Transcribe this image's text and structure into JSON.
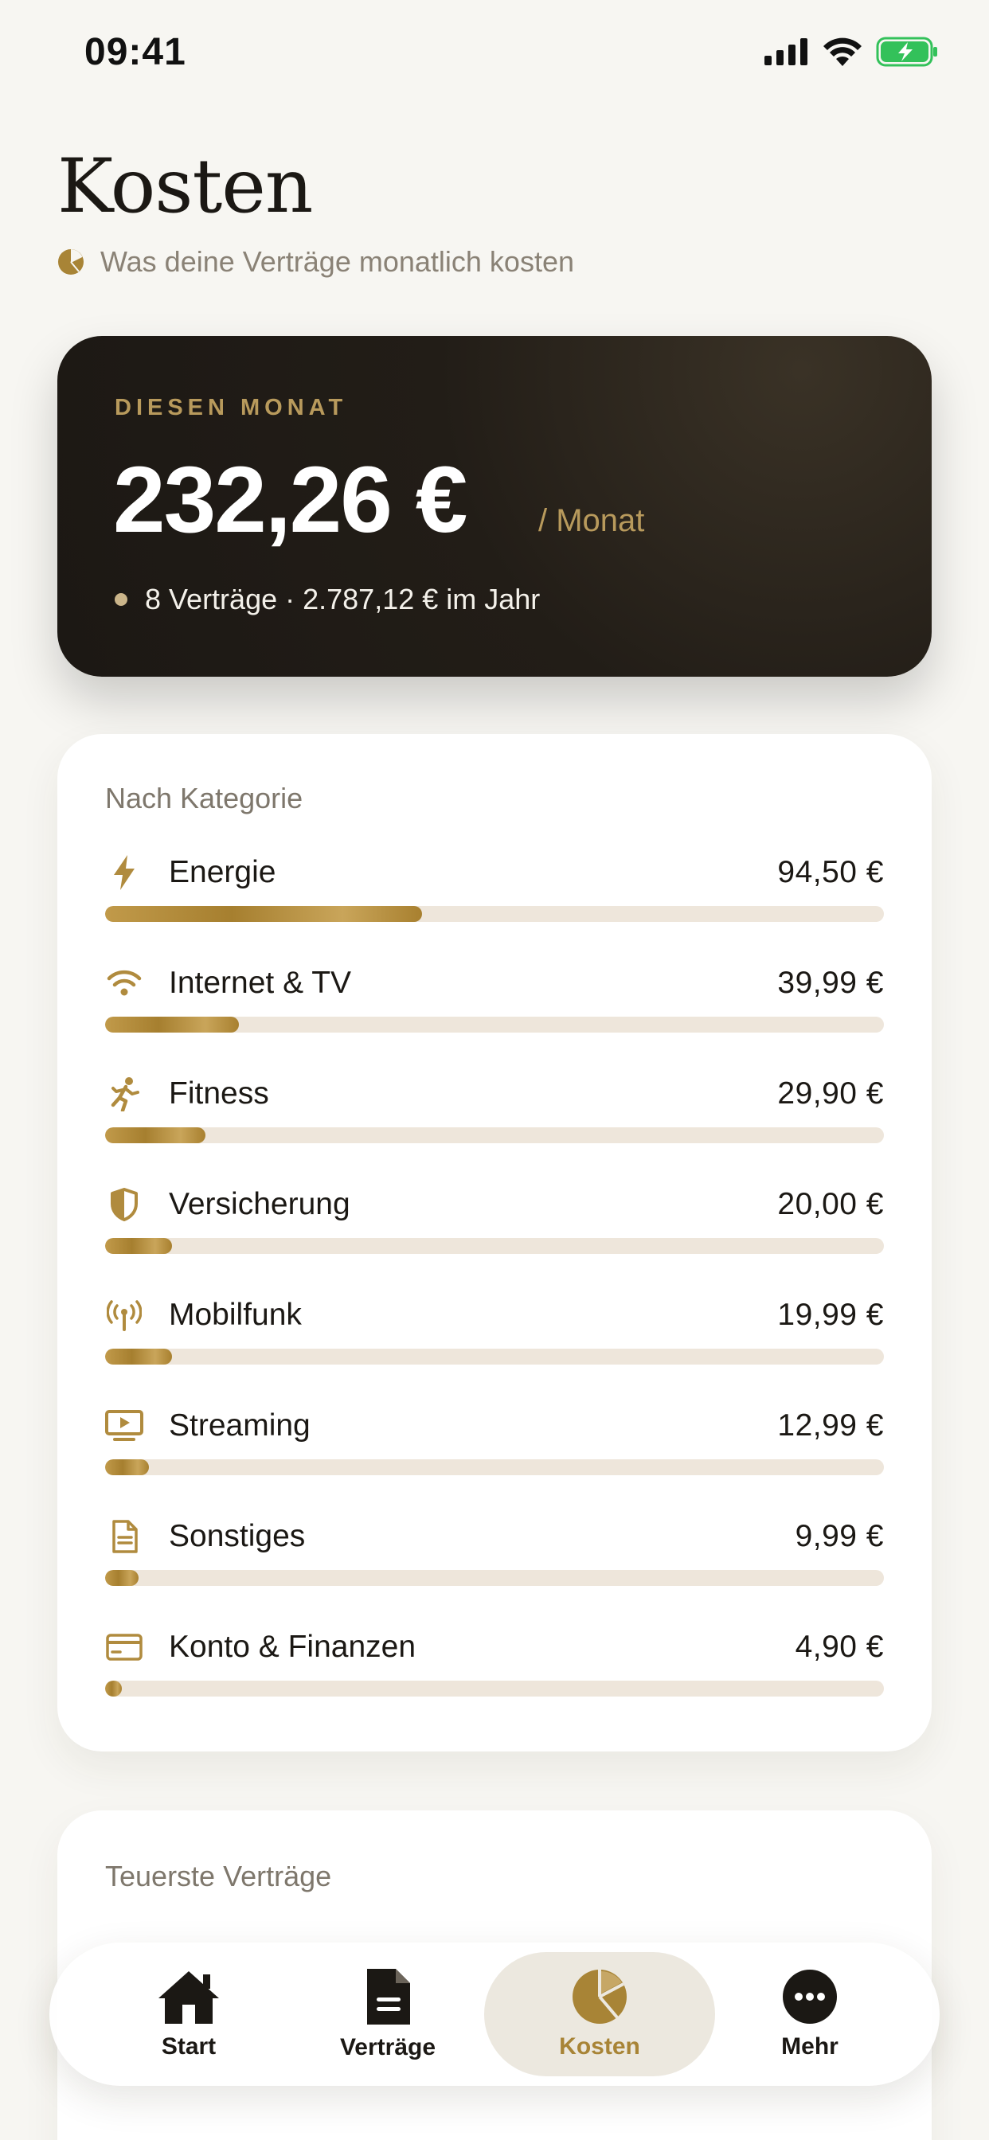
{
  "status_bar": {
    "time": "09:41"
  },
  "header": {
    "title": "Kosten",
    "subtitle": "Was deine Verträge monatlich kosten",
    "subtitle_icon": "pie-chart-icon"
  },
  "summary": {
    "eyebrow": "DIESEN MONAT",
    "amount": "232,26 €",
    "period": "/ Monat",
    "meta": "8 Verträge · 2.787,12 € im Jahr"
  },
  "categories": {
    "heading": "Nach Kategorie",
    "items": [
      {
        "label": "Energie",
        "value": "94,50 €",
        "icon": "bolt-icon",
        "fraction": 0.407
      },
      {
        "label": "Internet & TV",
        "value": "39,99 €",
        "icon": "wifi-icon",
        "fraction": 0.172
      },
      {
        "label": "Fitness",
        "value": "29,90 €",
        "icon": "running-icon",
        "fraction": 0.129
      },
      {
        "label": "Versicherung",
        "value": "20,00 €",
        "icon": "shield-icon",
        "fraction": 0.086
      },
      {
        "label": "Mobilfunk",
        "value": "19,99 €",
        "icon": "antenna-icon",
        "fraction": 0.086
      },
      {
        "label": "Streaming",
        "value": "12,99 €",
        "icon": "tv-play-icon",
        "fraction": 0.056
      },
      {
        "label": "Sonstiges",
        "value": "9,99 €",
        "icon": "document-icon",
        "fraction": 0.043
      },
      {
        "label": "Konto & Finanzen",
        "value": "4,90 €",
        "icon": "credit-card-icon",
        "fraction": 0.021
      }
    ]
  },
  "top_contracts": {
    "heading": "Teuerste Verträge"
  },
  "tab_bar": {
    "tabs": [
      {
        "label": "Start",
        "icon": "home-icon",
        "active": false
      },
      {
        "label": "Verträge",
        "icon": "document-icon",
        "active": false
      },
      {
        "label": "Kosten",
        "icon": "pie-chart-icon",
        "active": true
      },
      {
        "label": "Mehr",
        "icon": "more-icon",
        "active": false
      }
    ]
  },
  "colors": {
    "accent": "#b08b3e",
    "background": "#f7f6f2",
    "card_dark": "#1f1a15",
    "track": "#eee6db"
  }
}
